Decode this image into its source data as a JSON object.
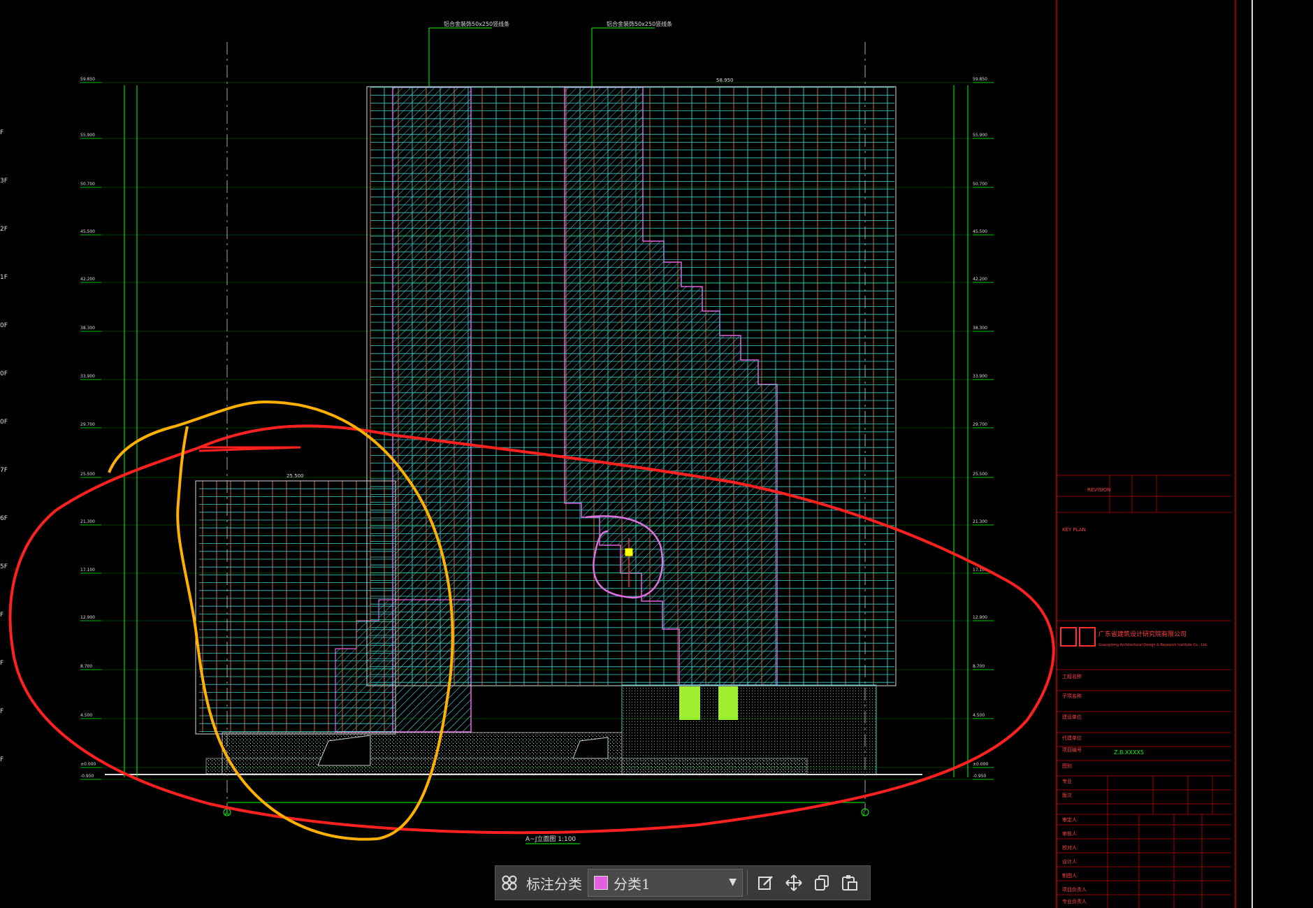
{
  "colors": {
    "background": "#000000",
    "axis_green": "#00ff00",
    "grid_cyan": "#3fd0d0",
    "mullion_orange": "#d87a50",
    "annot_red": "#ff2020",
    "annot_orange": "#ffb000",
    "annot_magenta": "#e070e0",
    "title_red": "#c00000",
    "swatch_magenta": "#e060e0"
  },
  "drawing": {
    "elevation_marks": [
      "59.850",
      "55.900",
      "50.700",
      "45.500",
      "42.200",
      "38.300",
      "33.900",
      "29.700",
      "25.500",
      "21.300",
      "17.100",
      "12.900",
      "8.700",
      "4.500",
      "±0.000",
      "-0.950"
    ],
    "left_floor_labels": [
      "F",
      "3F",
      "2F",
      "1F",
      "0F",
      "0F",
      "0F",
      "7F",
      "6F",
      "5F",
      "F",
      "F",
      "F",
      "F"
    ],
    "top_note_1": "铝合金装饰50x250竖线条",
    "top_note_2": "铝合金装饰50x250竖线条",
    "axis_a": "A",
    "axis_j": "J",
    "view_title": "A~J立面图 1:100",
    "mid_dim": "58.950",
    "annex_dim": "25.500"
  },
  "titleblock": {
    "company": "广东省建筑设计研究院有限公司",
    "company_en": "Guangdong Architectural Design & Research Institute Co., Ltd.",
    "key_plan": "KEY PLAN",
    "project_code": "Z.B.XXXX5",
    "revision_label": "REVISION",
    "row_labels": [
      "工程名称",
      "子项名称",
      "建设单位",
      "代建单位",
      "项目编号",
      "图别",
      "专业",
      "版次",
      "审定人",
      "审核人",
      "校对人",
      "设计人",
      "制图人",
      "项目负责人",
      "专业负责人"
    ]
  },
  "toolbar": {
    "label": "标注分类",
    "category": "分类1",
    "icons": [
      "grid-icon",
      "edit-icon",
      "move-icon",
      "copy-icon",
      "paste-icon"
    ]
  }
}
